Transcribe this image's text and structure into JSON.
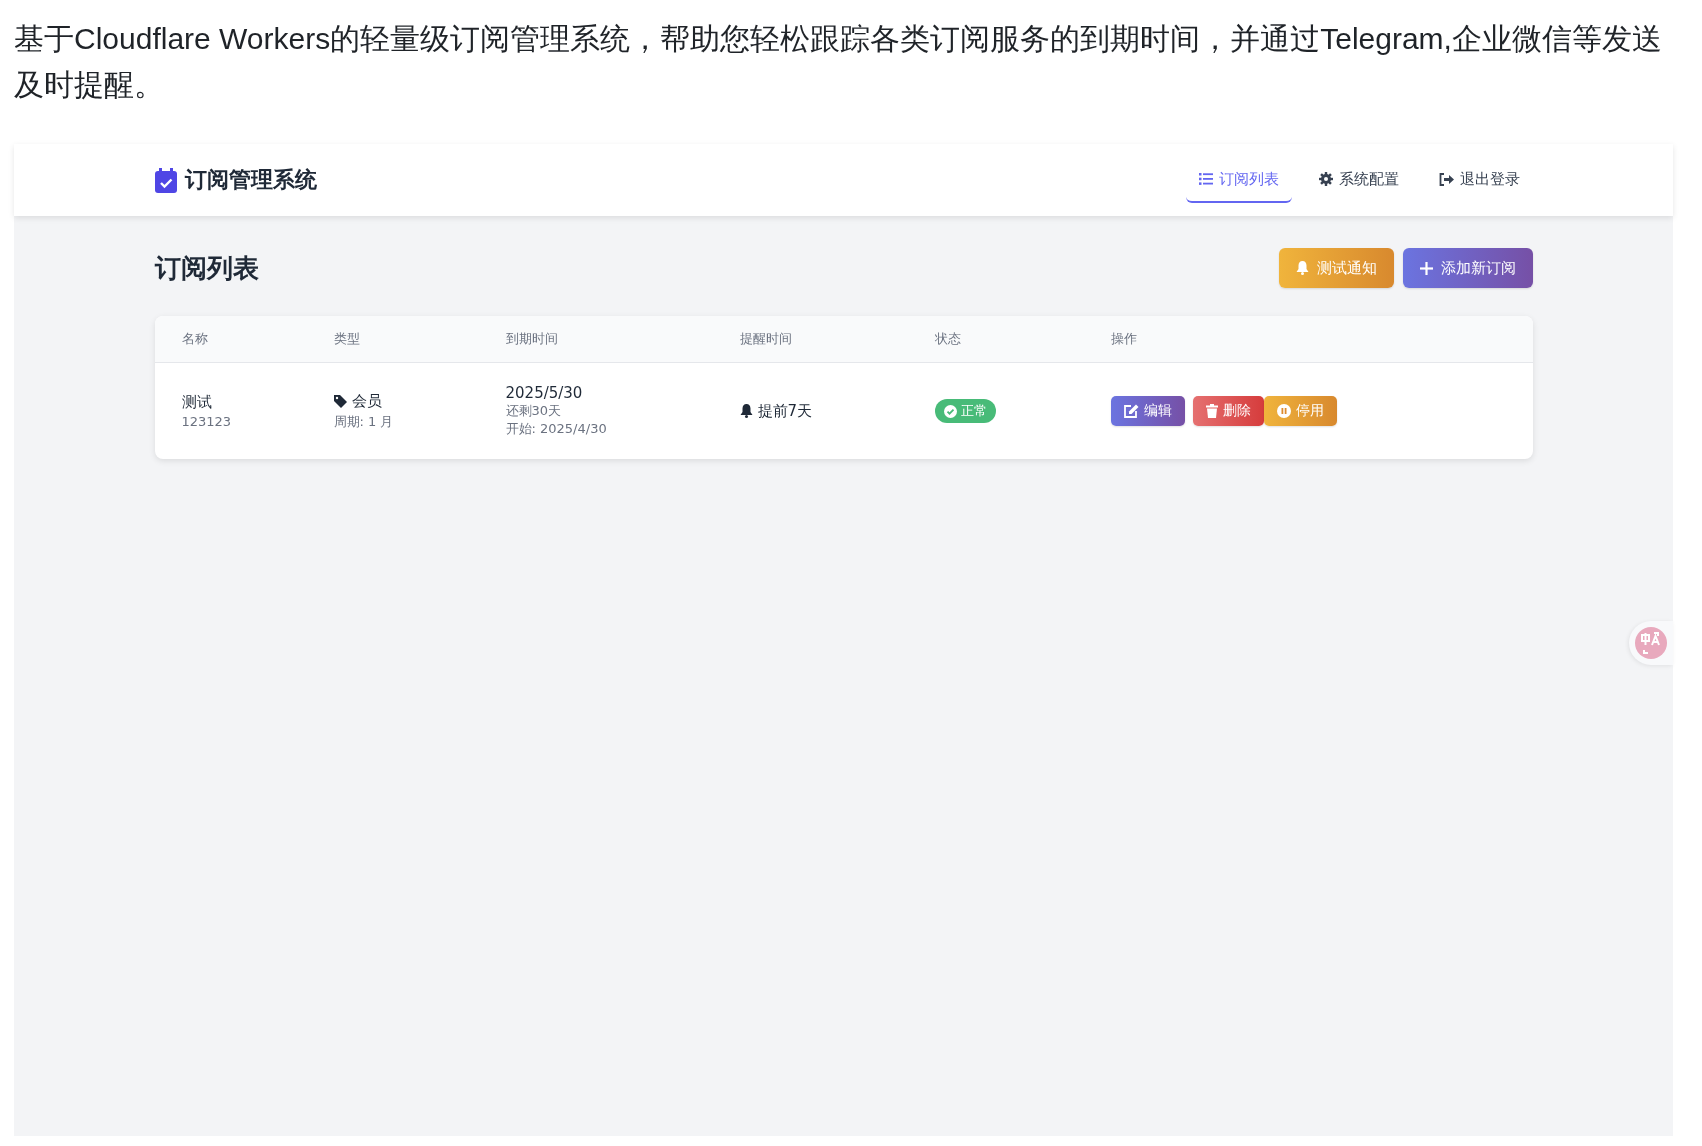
{
  "intro": "基于Cloudflare Workers的轻量级订阅管理系统，帮助您轻松跟踪各类订阅服务的到期时间，并通过Telegram,企业微信等发送及时提醒。",
  "app": {
    "brand": "订阅管理系统",
    "nav": [
      {
        "label": "订阅列表",
        "selected": true
      },
      {
        "label": "系统配置",
        "selected": false
      },
      {
        "label": "退出登录",
        "selected": false
      }
    ],
    "page_title": "订阅列表",
    "toolbar": [
      {
        "label": "测试通知",
        "kind": "warning"
      },
      {
        "label": "添加新订阅",
        "kind": "primary"
      }
    ],
    "table": {
      "columns": [
        "名称",
        "类型",
        "到期时间",
        "提醒时间",
        "状态",
        "操作"
      ],
      "rows": [
        {
          "name": "测试",
          "note": "123123",
          "type": "会员",
          "period": "周期: 1 月",
          "expiry": "2025/5/30",
          "remaining": "还剩30天",
          "start": "开始: 2025/4/30",
          "reminder": "提前7天",
          "status": {
            "label": "正常",
            "kind": "ok"
          },
          "actions": [
            {
              "label": "编辑",
              "kind": "primary"
            },
            {
              "label": "删除",
              "kind": "danger"
            },
            {
              "label": "停用",
              "kind": "warning"
            }
          ]
        }
      ]
    }
  }
}
